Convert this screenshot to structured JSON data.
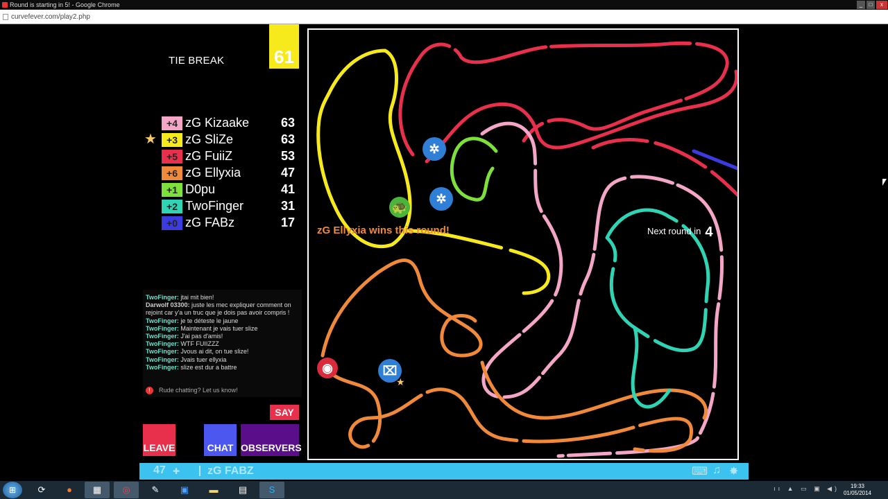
{
  "window": {
    "title": "Round is starting in 5!  - Google Chrome",
    "url": "curvefever.com/play2.php",
    "buttons": {
      "minimize": "_",
      "maximize": "□",
      "close": "x"
    }
  },
  "game": {
    "round_label": "TIE BREAK",
    "goal_score": "61",
    "win_message": "zG Ellyxia wins this round!",
    "next_round_label": "Next round in",
    "next_round_count": "4"
  },
  "scoreboard": [
    {
      "delta": "+4",
      "name": "zG Kizaake",
      "score": "63",
      "color": "#f4a6c6",
      "leader": false
    },
    {
      "delta": "+3",
      "name": "zG SliZe",
      "score": "63",
      "color": "#f7ea1c",
      "leader": true
    },
    {
      "delta": "+5",
      "name": "zG FuiiZ",
      "score": "53",
      "color": "#e8304d",
      "leader": false
    },
    {
      "delta": "+6",
      "name": "zG Ellyxia",
      "score": "47",
      "color": "#f08a3a",
      "leader": false
    },
    {
      "delta": "+1",
      "name": "D0pu",
      "score": "41",
      "color": "#7ee03a",
      "leader": false
    },
    {
      "delta": "+2",
      "name": "TwoFinger",
      "score": "31",
      "color": "#2fd4b4",
      "leader": false
    },
    {
      "delta": "+0",
      "name": "zG FABz",
      "score": "17",
      "color": "#3b3be0",
      "leader": false
    }
  ],
  "chat": {
    "messages": [
      {
        "author": "TwoFinger:",
        "text": " jtai mit bien!",
        "alt": false
      },
      {
        "author": "Darwolf 03300:",
        "text": " juste les mec expliquer comment on rejoint car y'a un truc que je dois pas avoir compris !",
        "alt": true
      },
      {
        "author": "TwoFinger:",
        "text": " je te déteste le jaune",
        "alt": false
      },
      {
        "author": "TwoFinger:",
        "text": " Maintenant je vais tuer slize",
        "alt": false
      },
      {
        "author": "TwoFinger:",
        "text": " J'ai pas d'amis!",
        "alt": false
      },
      {
        "author": "TwoFinger:",
        "text": " WTF FUIIZZZ",
        "alt": false
      },
      {
        "author": "TwoFinger:",
        "text": " Jvous ai dit, on tue slize!",
        "alt": false
      },
      {
        "author": "TwoFinger:",
        "text": " Jvais tuer ellyxia",
        "alt": false
      },
      {
        "author": "TwoFinger:",
        "text": " slize est dur a battre",
        "alt": false
      }
    ],
    "report_text": "Rude chatting? Let us know!",
    "input_value": "",
    "say_label": "SAY"
  },
  "buttons": {
    "leave": "LEAVE",
    "chat": "CHAT",
    "observers": "OBSERVERS"
  },
  "status_bar": {
    "level": "47",
    "username": "zG FABZ"
  },
  "taskbar": {
    "time": "19:33",
    "date": "01/05/2014"
  }
}
